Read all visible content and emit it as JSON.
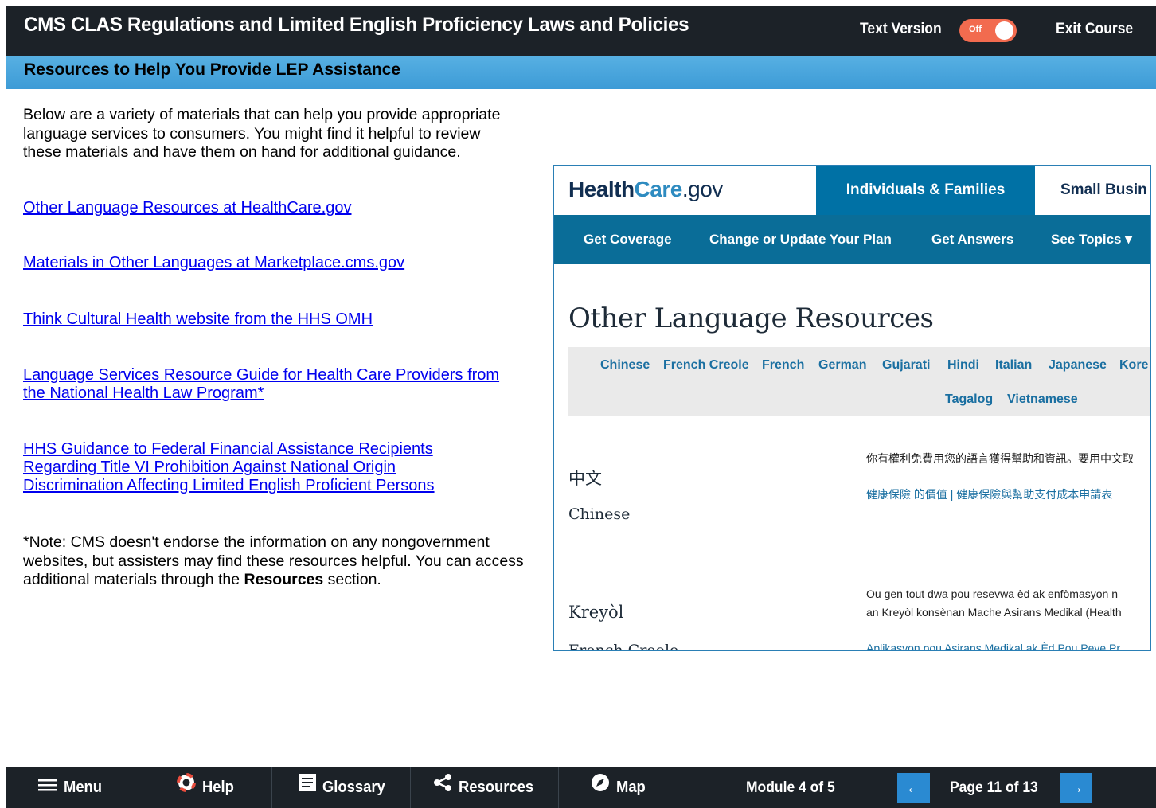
{
  "header": {
    "course_title": "CMS CLAS Regulations and Limited English Proficiency Laws and Policies",
    "text_version_label": "Text Version",
    "toggle_state": "Off",
    "exit_label": "Exit Course",
    "accent_color": "#f26b4f"
  },
  "section": {
    "title": "Resources to Help You Provide LEP Assistance"
  },
  "content": {
    "intro": "Below are a variety of materials that can help you provide appropriate language services to consumers. You might find it helpful to review these materials and have them on hand for additional guidance.",
    "links": [
      "Other Language Resources at HealthCare.gov",
      "Materials in Other Languages at Marketplace.cms.gov",
      "Think Cultural Health website from the HHS OMH",
      "Language Services Resource Guide for Health Care Providers from the National Health Law Program*",
      "HHS Guidance to Federal Financial Assistance Recipients Regarding Title VI Prohibition Against National Origin Discrimination Affecting Limited English Proficient Persons"
    ],
    "note_prefix": "*Note: CMS doesn't endorse the information on any nongovernment websites, but assisters may find these resources helpful. You can access additional materials through the ",
    "note_bold": "Resources",
    "note_suffix": " section."
  },
  "screenshot": {
    "logo_health": "Health",
    "logo_care": "Care",
    "logo_gov": ".gov",
    "tab_active": "Individuals & Families",
    "tab_other": "Small Busin",
    "nav": [
      "Get Coverage",
      "Change or Update Your Plan",
      "Get Answers",
      "See Topics ▾"
    ],
    "heading": "Other Language Resources",
    "languages_row1": [
      "Chinese",
      "French Creole",
      "French",
      "German",
      "Gujarati",
      "Hindi",
      "Italian",
      "Japanese",
      "Kore"
    ],
    "languages_row2": [
      "Tagalog",
      "Vietnamese"
    ],
    "chinese_native": "中文",
    "chinese_english": "Chinese",
    "chinese_text": "你有權利免費用您的語言獲得幫助和資訊。要用中文取",
    "chinese_links": "健康保險 的價值 | 健康保險與幫助支付成本申請表",
    "creole_native": "Kreyòl",
    "creole_english": "French Creole",
    "creole_text1": "Ou gen tout dwa pou resevwa èd ak enfòmasyon n",
    "creole_text2": "an Kreyòl konsènan Mache Asirans Medikal (Health",
    "creole_link": "Aplikasyon pou Asirans Medikal ak Èd Pou Peye Pr"
  },
  "footer": {
    "menu": "Menu",
    "help": "Help",
    "glossary": "Glossary",
    "resources": "Resources",
    "map": "Map",
    "module": "Module 4 of 5",
    "prev": "←",
    "page": "Page 11 of 13",
    "next": "→"
  }
}
